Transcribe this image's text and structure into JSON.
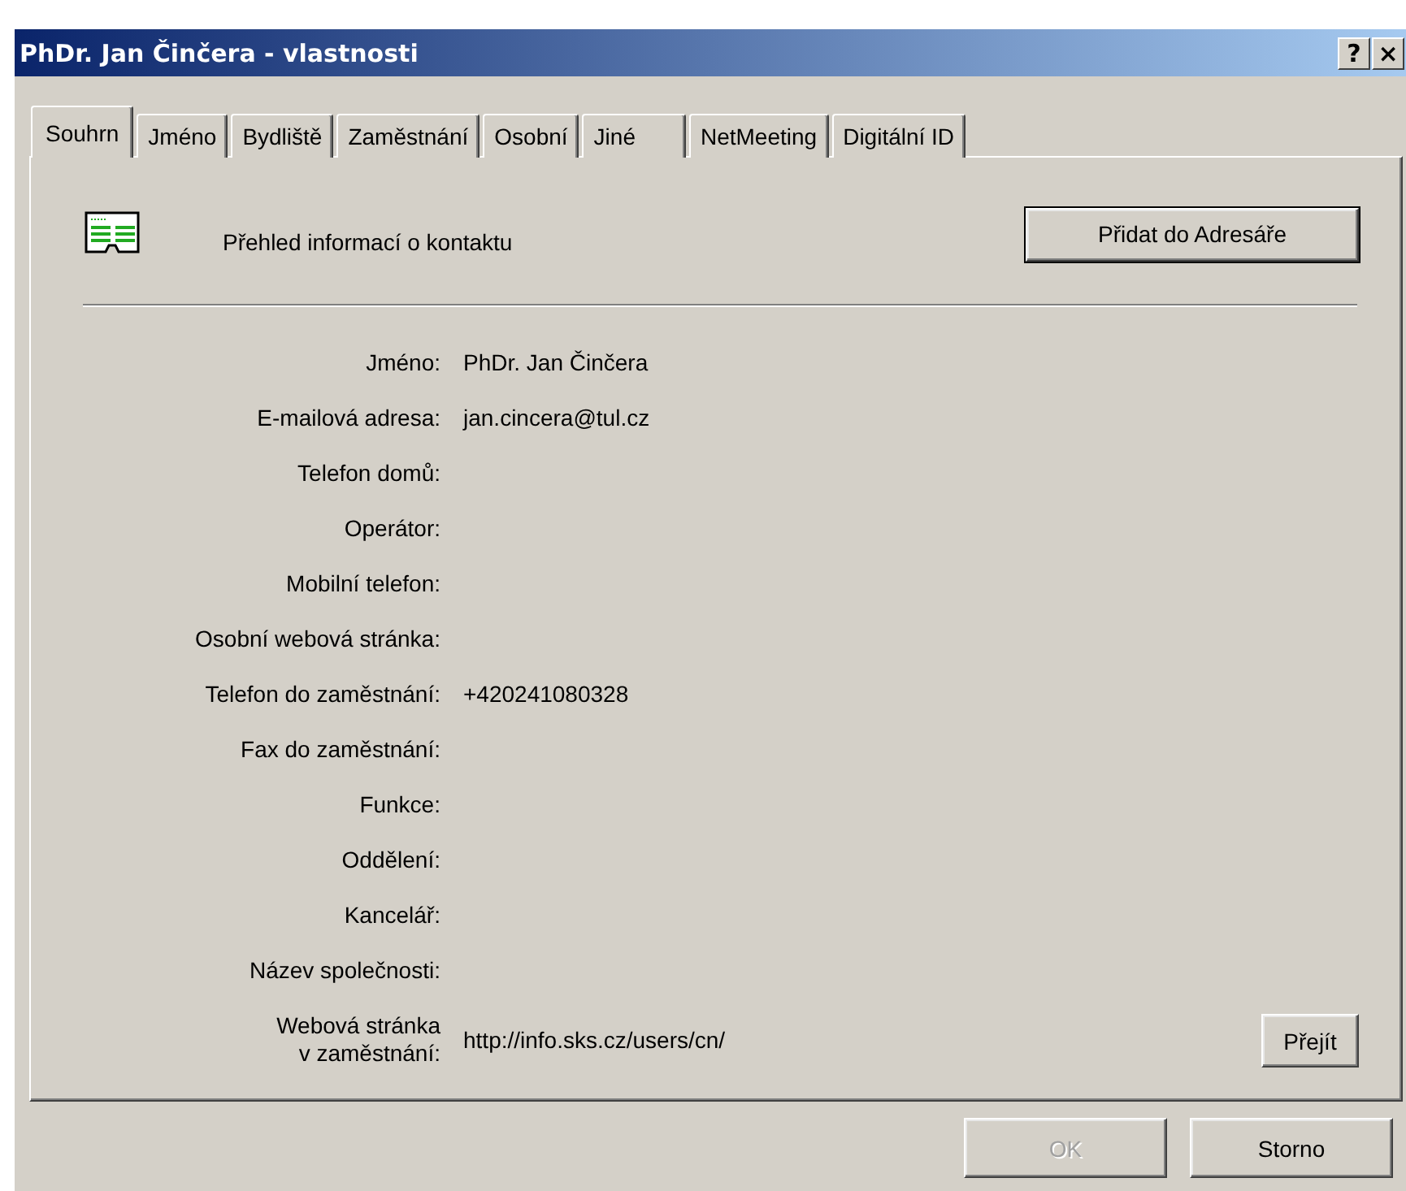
{
  "window": {
    "title": "PhDr. Jan Činčera - vlastnosti",
    "title_buttons": [
      "?",
      "×"
    ]
  },
  "tabs": [
    {
      "label": "Souhrn",
      "selected": true
    },
    {
      "label": "Jméno",
      "selected": false
    },
    {
      "label": "Bydliště",
      "selected": false
    },
    {
      "label": "Zaměstnání",
      "selected": false
    },
    {
      "label": "Osobní",
      "selected": false
    },
    {
      "label": "Jiné",
      "selected": false
    },
    {
      "label": "NetMeeting",
      "selected": false
    },
    {
      "label": "Digitální ID",
      "selected": false
    }
  ],
  "summary": {
    "heading": "Přehled informací o kontaktu",
    "add_button": "Přidat do Adresáře"
  },
  "fields": [
    {
      "label": "Jméno:",
      "value": "PhDr. Jan Činčera"
    },
    {
      "label": "E-mailová adresa:",
      "value": "jan.cincera@tul.cz"
    },
    {
      "label": "Telefon domů:"
    },
    {
      "label": "Operátor:"
    },
    {
      "label": "Mobilní telefon:"
    },
    {
      "label": "Osobní webová stránka:"
    },
    {
      "label": "Telefon do zaměstnání:",
      "value": "+420241080328"
    },
    {
      "label": "Fax do zaměstnání:"
    },
    {
      "label": "Funkce:"
    },
    {
      "label": "Oddělení:"
    },
    {
      "label": "Kancelář:"
    },
    {
      "label": "Název společnosti:"
    },
    {
      "label": "Webová stránka\nv zaměstnání:",
      "value": "http://info.sks.cz/users/cn/",
      "button": "Přejít"
    }
  ],
  "buttons": [
    {
      "label": "OK",
      "disabled": true
    },
    {
      "label": "Storno",
      "disabled": false
    }
  ]
}
